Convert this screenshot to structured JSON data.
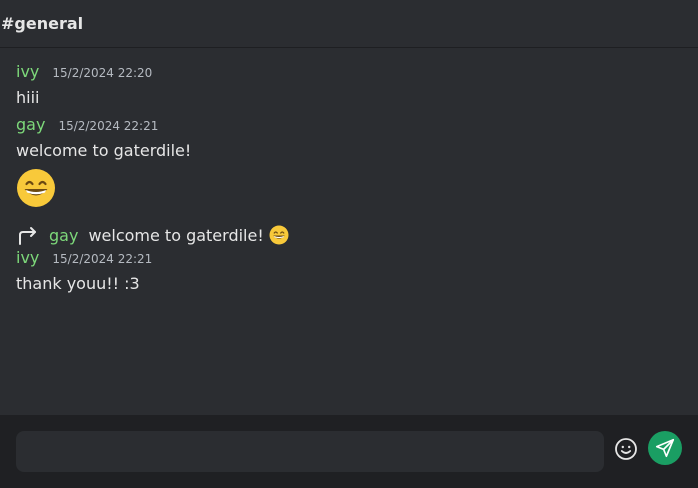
{
  "header": {
    "title": "#general"
  },
  "messages": [
    {
      "author": "ivy",
      "time": "15/2/2024 22:20",
      "text": "hiii"
    },
    {
      "author": "gay",
      "time": "15/2/2024 22:21",
      "text": "welcome to gaterdile!",
      "emoji": "grinning-face-with-smiling-eyes"
    },
    {
      "reply": {
        "author": "gay",
        "text": "welcome to gaterdile!",
        "emoji": "grinning-face-with-smiling-eyes"
      },
      "author": "ivy",
      "time": "15/2/2024 22:21",
      "text": "thank youu!! :3"
    }
  ],
  "composer": {
    "placeholder": "",
    "emoji_icon": "smiley-icon",
    "send_icon": "paper-plane-icon",
    "send_color": "#1a9e63"
  },
  "colors": {
    "author": "#7dd87a",
    "background": "#2b2d31",
    "composer_background": "#1f2023"
  }
}
